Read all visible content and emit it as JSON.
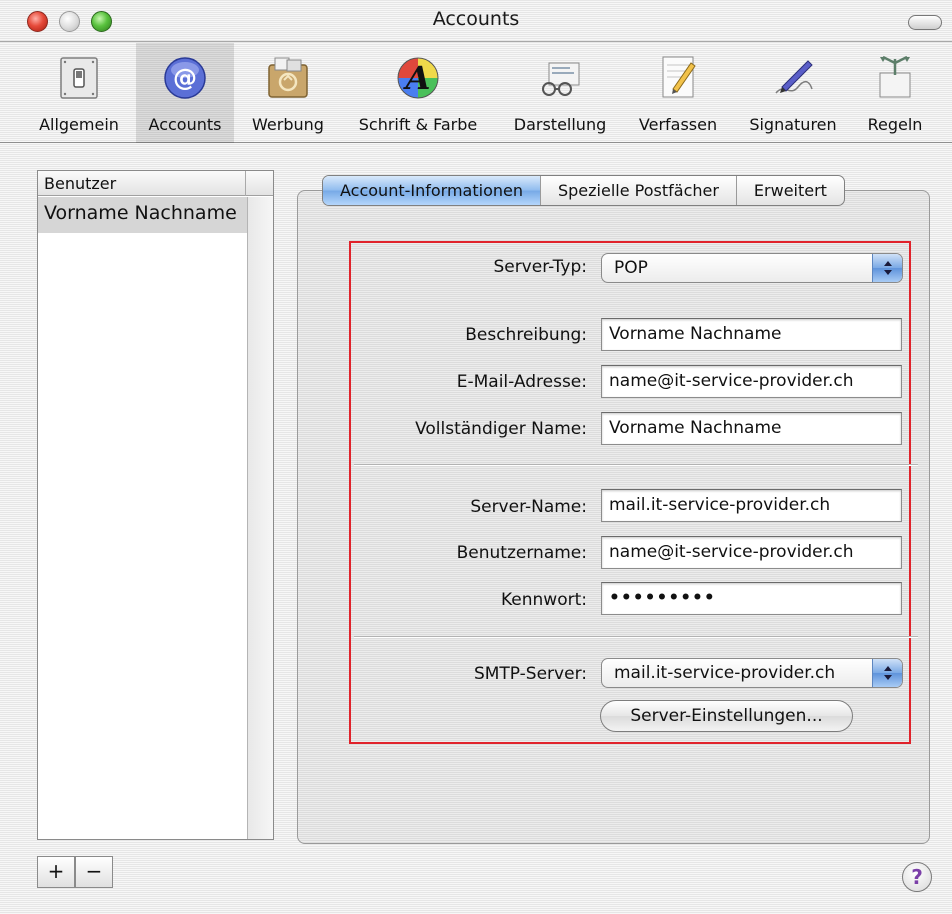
{
  "window": {
    "title": "Accounts"
  },
  "toolbar": {
    "items": [
      {
        "label": "Allgemein",
        "icon": "general-switch-icon"
      },
      {
        "label": "Accounts",
        "icon": "at-sign-icon",
        "selected": true
      },
      {
        "label": "Werbung",
        "icon": "junk-mail-icon"
      },
      {
        "label": "Schrift & Farbe",
        "icon": "font-color-icon"
      },
      {
        "label": "Darstellung",
        "icon": "viewing-glasses-icon"
      },
      {
        "label": "Verfassen",
        "icon": "compose-pencil-icon"
      },
      {
        "label": "Signaturen",
        "icon": "signature-pen-icon"
      },
      {
        "label": "Regeln",
        "icon": "rules-icon"
      }
    ]
  },
  "accounts_list": {
    "header": "Benutzer",
    "items": [
      "Vorname Nachname"
    ],
    "add_label": "+",
    "remove_label": "−"
  },
  "tabs": {
    "items": [
      "Account-Informationen",
      "Spezielle Postfächer",
      "Erweitert"
    ],
    "active": "Account-Informationen"
  },
  "form": {
    "server_type": {
      "label": "Server-Typ:",
      "value": "POP"
    },
    "description": {
      "label": "Beschreibung:",
      "value": "Vorname Nachname"
    },
    "email": {
      "label": "E-Mail-Adresse:",
      "value": "name@it-service-provider.ch"
    },
    "full_name": {
      "label": "Vollständiger Name:",
      "value": "Vorname Nachname"
    },
    "server_name": {
      "label": "Server-Name:",
      "value": "mail.it-service-provider.ch"
    },
    "username": {
      "label": "Benutzername:",
      "value": "name@it-service-provider.ch"
    },
    "password": {
      "label": "Kennwort:",
      "value": "•••••••••"
    },
    "smtp_server": {
      "label": "SMTP-Server:",
      "value": "mail.it-service-provider.ch"
    },
    "server_settings_button": "Server-Einstellungen..."
  },
  "help": {
    "label": "?"
  },
  "colors": {
    "highlight_box": "#e0222b",
    "tab_active": "#8fbbee"
  }
}
